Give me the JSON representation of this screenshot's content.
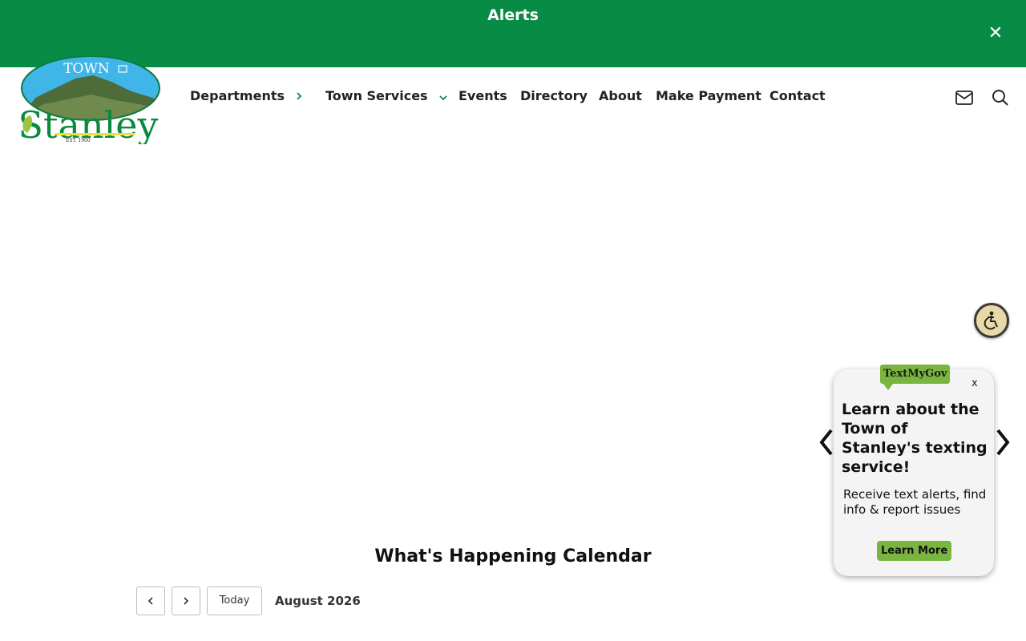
{
  "alerts": {
    "title": "Alerts",
    "close_label": "✕",
    "background": "#088b45"
  },
  "logo": {
    "top_text": "TOWN",
    "name": "Stanley",
    "est": "EST. 1900"
  },
  "nav": {
    "departments": "Departments",
    "town_services": "Town Services",
    "events": "Events",
    "directory": "Directory",
    "about": "About",
    "make_payment": "Make Payment",
    "contact": "Contact"
  },
  "header_icons": [
    "mail-icon",
    "search-icon"
  ],
  "textmygov": {
    "badge": "TextMyGov",
    "close": "x",
    "heading": "Learn about the Town of Stanley's texting service!",
    "body": "Receive text alerts, find info & report issues",
    "button": "Learn More",
    "accent": "#7ab63f"
  },
  "calendar": {
    "title": "What's Happening Calendar",
    "today_label": "Today",
    "month": "August 2026"
  }
}
